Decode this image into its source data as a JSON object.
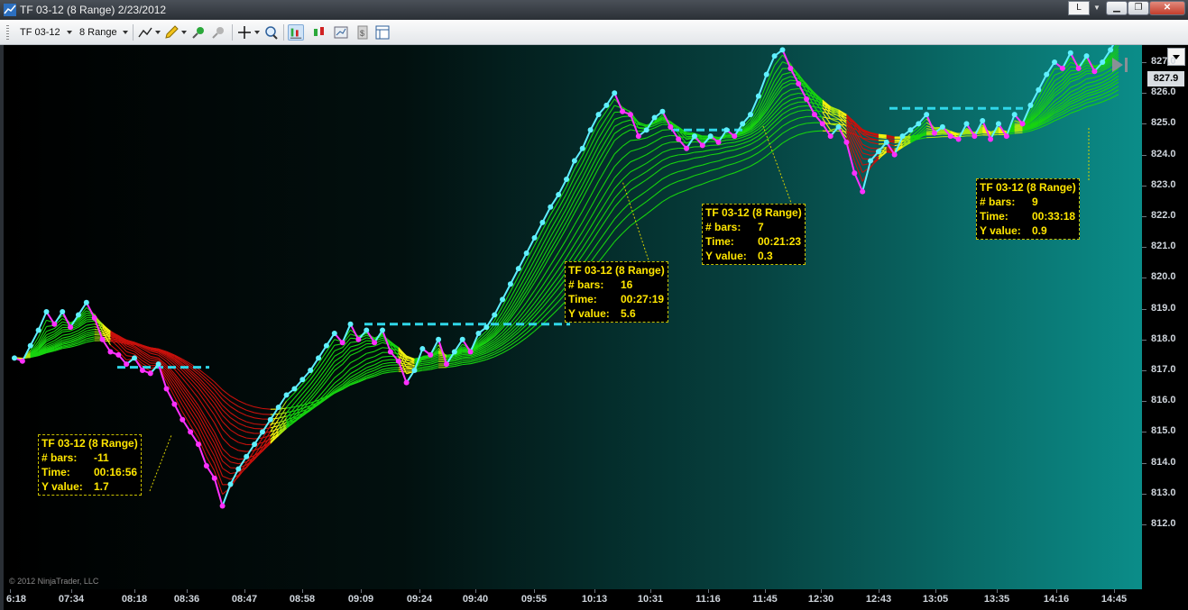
{
  "window": {
    "title": "TF 03-12 (8 Range)  2/23/2012",
    "language_indicator": "L",
    "controls": [
      "minimize-icon",
      "maximize-icon",
      "close-icon"
    ]
  },
  "toolbar": {
    "instrument": "TF 03-12",
    "period": "8 Range",
    "icons": [
      "line-tool-icon",
      "pencil-icon",
      "zoom-in-icon",
      "zoom-out-icon",
      "crosshair-icon",
      "search-icon",
      "bar-style-icon",
      "candlestick-icon",
      "chart-properties-icon",
      "data-box-icon",
      "panel-icon"
    ]
  },
  "chart": {
    "copyright": "© 2012 NinjaTrader, LLC",
    "current_price": "827.9",
    "y_ticks": [
      "827.0",
      "826.0",
      "825.0",
      "824.0",
      "823.0",
      "822.0",
      "821.0",
      "820.0",
      "819.0",
      "818.0",
      "817.0",
      "816.0",
      "815.0",
      "814.0",
      "813.0",
      "812.0"
    ],
    "x_ticks": [
      "6:18",
      "07:34",
      "08:18",
      "08:36",
      "08:47",
      "08:58",
      "09:09",
      "09:24",
      "09:40",
      "09:55",
      "10:13",
      "10:31",
      "11:16",
      "11:45",
      "12:30",
      "12:43",
      "13:05",
      "13:35",
      "14:16",
      "14:45"
    ],
    "colors": {
      "up_line": "#5ff0ff",
      "down_line": "#ff30ff",
      "dash": "#2fd6e8",
      "callout_text": "#ffe600"
    },
    "callouts": [
      {
        "title": "TF 03-12 (8 Range)",
        "bars_label": "# bars:",
        "bars": "-11",
        "time_label": "Time:",
        "time": "00:16:56",
        "y_label": "Y value:",
        "y": "1.7"
      },
      {
        "title": "TF 03-12 (8 Range)",
        "bars_label": "# bars:",
        "bars": "16",
        "time_label": "Time:",
        "time": "00:27:19",
        "y_label": "Y value:",
        "y": "5.6"
      },
      {
        "title": "TF 03-12 (8 Range)",
        "bars_label": "# bars:",
        "bars": "7",
        "time_label": "Time:",
        "time": "00:21:23",
        "y_label": "Y value:",
        "y": "0.3"
      },
      {
        "title": "TF 03-12 (8 Range)",
        "bars_label": "# bars:",
        "bars": "9",
        "time_label": "Time:",
        "time": "00:33:18",
        "y_label": "Y value:",
        "y": "0.9"
      }
    ],
    "price_path": [
      817.4,
      817.3,
      817.8,
      818.3,
      818.9,
      818.5,
      818.9,
      818.4,
      818.8,
      819.2,
      818.7,
      818.0,
      817.6,
      817.5,
      817.2,
      817.4,
      817.0,
      816.9,
      817.2,
      816.4,
      815.9,
      815.4,
      815.0,
      814.6,
      813.9,
      813.5,
      812.6,
      813.3,
      813.8,
      814.2,
      814.6,
      815.0,
      815.4,
      815.8,
      816.2,
      816.4,
      816.7,
      817.0,
      817.4,
      817.8,
      818.2,
      817.9,
      818.5,
      818.0,
      818.3,
      817.9,
      818.3,
      817.6,
      817.3,
      816.6,
      817.0,
      817.7,
      817.5,
      818.0,
      817.2,
      817.6,
      818.0,
      817.6,
      818.2,
      818.4,
      818.8,
      819.3,
      819.8,
      820.3,
      820.8,
      821.3,
      821.8,
      822.3,
      822.7,
      823.2,
      823.8,
      824.2,
      824.8,
      825.3,
      825.6,
      826.0,
      825.4,
      825.3,
      824.6,
      824.8,
      825.2,
      825.4,
      824.9,
      824.5,
      824.2,
      824.6,
      824.3,
      824.6,
      824.4,
      824.8,
      824.6,
      825.0,
      825.3,
      825.9,
      826.6,
      827.2,
      827.4,
      826.8,
      826.3,
      825.8,
      825.3,
      825.0,
      824.6,
      824.9,
      824.4,
      823.4,
      822.8,
      823.8,
      824.1,
      824.4,
      824.0,
      824.6,
      824.8,
      825.0,
      825.3,
      824.7,
      824.9,
      824.6,
      824.5,
      825.0,
      824.6,
      825.1,
      824.5,
      825.0,
      824.6,
      825.3,
      825.0,
      825.6,
      826.1,
      826.6,
      827.0,
      826.8,
      827.3,
      826.8,
      827.2,
      826.7,
      827.0,
      827.4,
      827.9
    ]
  }
}
